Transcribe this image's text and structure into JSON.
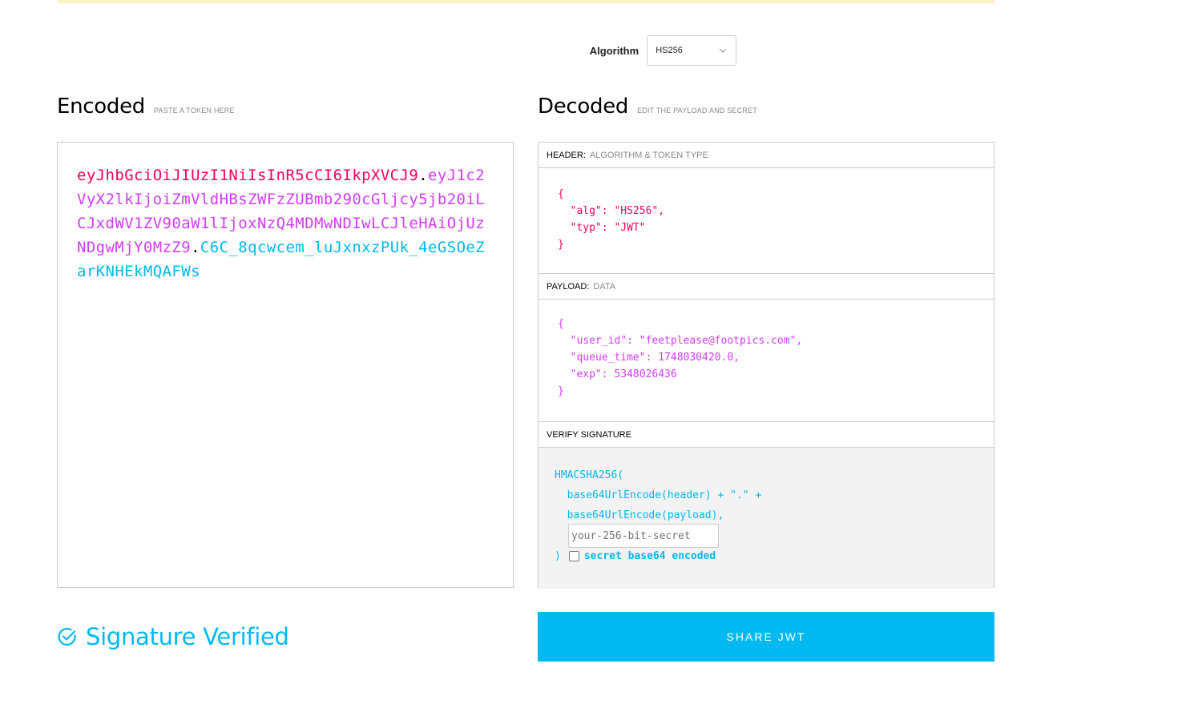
{
  "algorithm": {
    "label": "Algorithm",
    "selected": "HS256"
  },
  "encoded": {
    "title": "Encoded",
    "subtitle": "PASTE A TOKEN HERE",
    "token_header": "eyJhbGciOiJIUzI1NiIsInR5cCI6IkpXVCJ9",
    "token_payload": "eyJ1c2VyX2lkIjoiZmVldHBsZWFzZUBmb290cGljcy5jb20iLCJxdWV1ZV90aW1lIjoxNzQ4MDMwNDIwLCJleHAiOjUzNDgwMjY0MzZ9",
    "token_signature": "C6C_8qcwcem_luJxnxzPUk_4eGSOeZarKNHEkMQAFWs",
    "dot": "."
  },
  "decoded": {
    "title": "Decoded",
    "subtitle": "EDIT THE PAYLOAD AND SECRET",
    "header_section": {
      "label": "HEADER:",
      "sublabel": "ALGORITHM & TOKEN TYPE",
      "json": "{\n  \"alg\": \"HS256\",\n  \"typ\": \"JWT\"\n}"
    },
    "payload_section": {
      "label": "PAYLOAD:",
      "sublabel": "DATA",
      "json": "{\n  \"user_id\": \"feetplease@footpics.com\",\n  \"queue_time\": 1748030420.0,\n  \"exp\": 5348026436\n}"
    },
    "verify_section": {
      "label": "VERIFY SIGNATURE",
      "code": "HMACSHA256(\n  base64UrlEncode(header) + \".\" +\n  base64UrlEncode(payload),",
      "secret_placeholder": "your-256-bit-secret",
      "close_paren": ")",
      "base64_label": "secret base64 encoded"
    }
  },
  "status": {
    "text": "Signature Verified",
    "icon": "check-circle-icon"
  },
  "share_button": {
    "label": "SHARE JWT"
  },
  "colors": {
    "header": "#fb015b",
    "payload": "#d63aff",
    "signature": "#00b9f1",
    "accent": "#00b9f1"
  }
}
